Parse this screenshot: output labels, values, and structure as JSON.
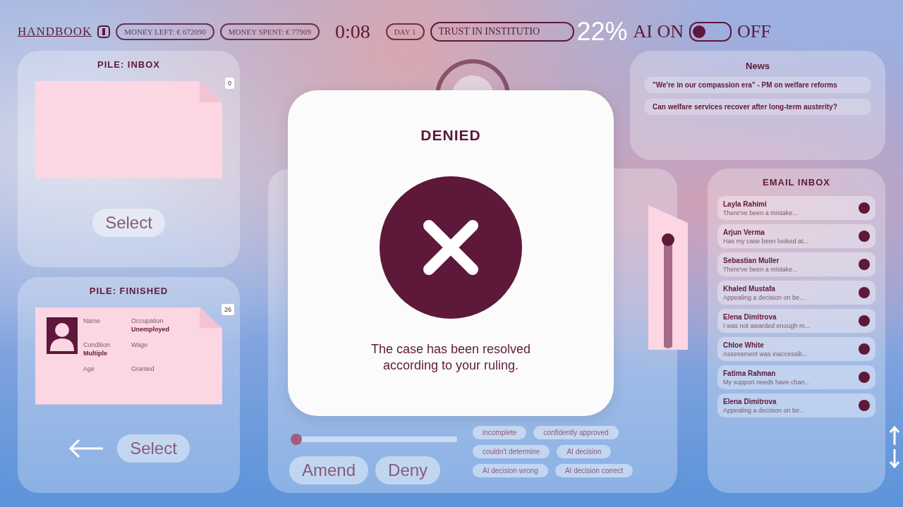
{
  "top_bar": {
    "handbook": "HANDBOOK",
    "money_left": "MONEY LEFT: € 672090",
    "money_spent": "MONEY SPENT: € 77909",
    "timer": "0:08",
    "day": "DAY 1",
    "trust": "TRUST IN INSTITUTIO",
    "trust_level": "22%",
    "ai_on": "AI ON",
    "ai_toggle_on": false,
    "ai_off": "OFF"
  },
  "piles": [
    {
      "title": "PILE: INBOX",
      "count": "0",
      "has_case": false,
      "button": "Select",
      "back": false
    },
    {
      "title": "PILE: FINISHED",
      "count": "26",
      "has_case": true,
      "button": "Select",
      "back": true,
      "fields": [
        {
          "label": "Name"
        },
        {
          "label": "Occupation",
          "value": "Unemployed"
        },
        {
          "label": "Condition",
          "value": "Multiple"
        },
        {
          "label": "Wage"
        },
        {
          "label": "Age"
        },
        {
          "label": "Granted"
        }
      ]
    }
  ],
  "case_panel": {
    "slider": {
      "level": 0
    },
    "doc_slider": {
      "level": 1
    },
    "buttons": [
      "Amend",
      "Deny"
    ],
    "tags": [
      "incomplete",
      "confidently approved",
      "couldn't determine",
      "AI decision",
      "AI decision wrong",
      "AI decision correct"
    ]
  },
  "news": {
    "title": "News",
    "items": [
      "\"We're in our compassion era\" - PM on welfare reforms",
      "Can welfare services recover after long-term austerity?"
    ]
  },
  "email_inbox": {
    "title": "EMAIL INBOX",
    "items": [
      {
        "name": "Layla Rahimi",
        "preview": "There've been a mistake...",
        "unread": true
      },
      {
        "name": "Arjun Verma",
        "preview": "Has my case been looked at...",
        "unread": true
      },
      {
        "name": "Sebastian Muller",
        "preview": "There've been a mistake...",
        "unread": true
      },
      {
        "name": "Khaled Mustafa",
        "preview": "Appealing a decision on be...",
        "unread": true
      },
      {
        "name": "Elena Dimitrova",
        "preview": "I was not awarded enough m...",
        "unread": true
      },
      {
        "name": "Chloe White",
        "preview": "Assessment was inaccessib...",
        "unread": true
      },
      {
        "name": "Fatima Rahman",
        "preview": "My support needs have chan...",
        "unread": true
      },
      {
        "name": "Elena Dimitrova",
        "preview": "Appealing a decision on be...",
        "unread": true
      }
    ]
  },
  "dialog": {
    "title": "DENIED",
    "message": "The case has been resolved according to your ruling."
  }
}
